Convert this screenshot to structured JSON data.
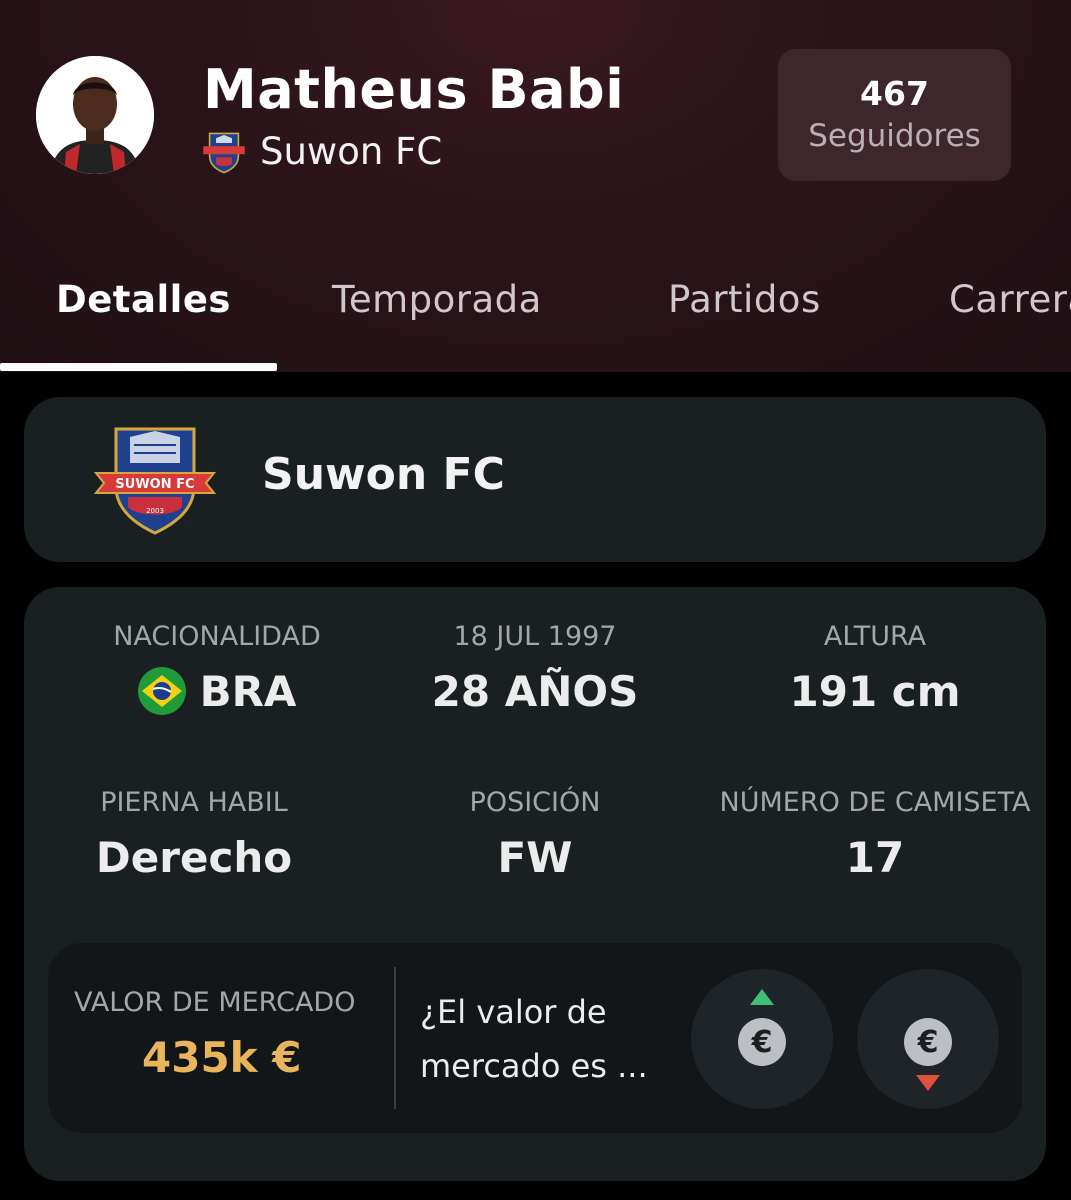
{
  "profile": {
    "name": "Matheus Babi",
    "team": "Suwon FC",
    "followers_count": "467",
    "followers_label": "Seguidores"
  },
  "tabs": [
    {
      "label": "Detalles",
      "active": true
    },
    {
      "label": "Temporada",
      "active": false
    },
    {
      "label": "Partidos",
      "active": false
    },
    {
      "label": "Carrera",
      "active": false
    }
  ],
  "team_card": {
    "name": "Suwon FC",
    "crest_text": "SUWON FC",
    "crest_year": "2003"
  },
  "details": {
    "nationality": {
      "label": "NACIONALIDAD",
      "value": "BRA"
    },
    "birth": {
      "label": "18 JUL 1997",
      "value": "28 AÑOS"
    },
    "height": {
      "label": "ALTURA",
      "value": "191 cm"
    },
    "foot": {
      "label": "PIERNA HABIL",
      "value": "Derecho"
    },
    "position": {
      "label": "POSICIÓN",
      "value": "FW"
    },
    "shirt": {
      "label": "NÚMERO DE CAMISETA",
      "value": "17"
    }
  },
  "market": {
    "label": "VALOR DE MERCADO",
    "value": "435k €",
    "question_line1": "¿El valor de",
    "question_line2": "mercado es ...",
    "vote_up_symbol": "€",
    "vote_down_symbol": "€"
  },
  "colors": {
    "header_bg": "#2a1419",
    "card_bg": "#1a1f22",
    "market_value": "#e9b55c",
    "vote_up": "#3fbf74",
    "vote_down": "#e0503f"
  }
}
